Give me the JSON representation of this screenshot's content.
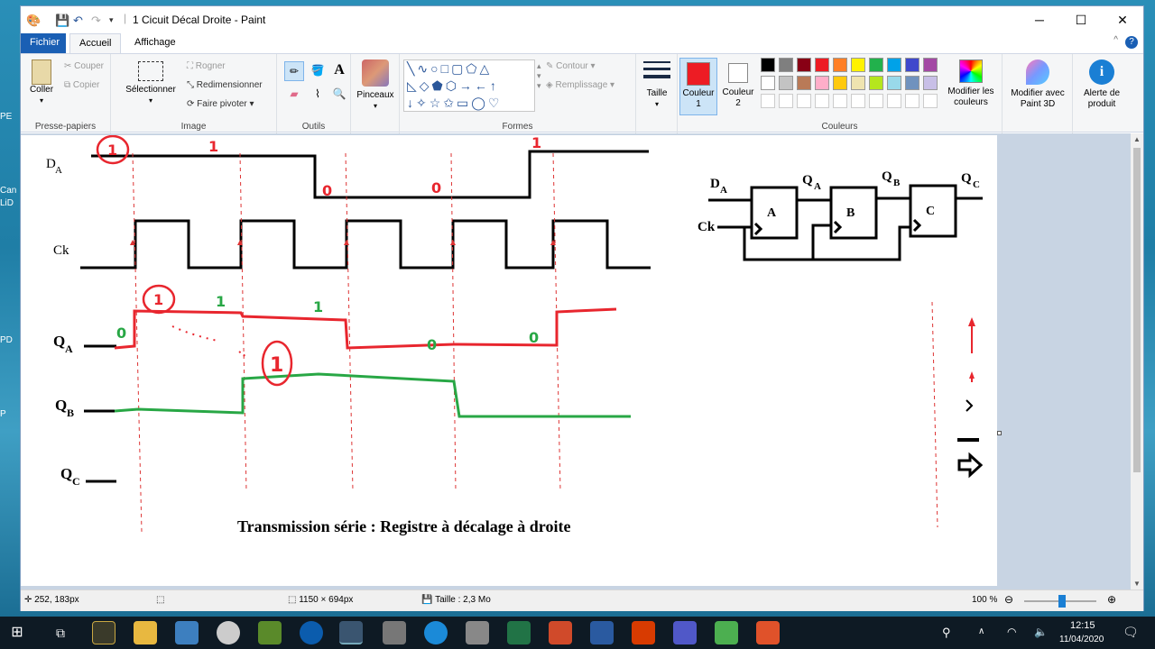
{
  "window": {
    "title": "1 Cicuit Décal Droite - Paint",
    "minimize": "─",
    "maximize": "☐",
    "close": "✕",
    "help": "?",
    "collapse": "^"
  },
  "tabs": {
    "file": "Fichier",
    "home": "Accueil",
    "view": "Affichage"
  },
  "ribbon": {
    "clipboard": {
      "paste": "Coller",
      "cut": "Couper",
      "copy": "Copier",
      "label": "Presse-papiers"
    },
    "image": {
      "select": "Sélectionner",
      "crop": "Rogner",
      "resize": "Redimensionner",
      "rotate": "Faire pivoter",
      "label": "Image"
    },
    "tools": {
      "label": "Outils"
    },
    "brushes": {
      "label": "Pinceaux"
    },
    "shapes": {
      "outline": "Contour",
      "fill": "Remplissage",
      "label": "Formes"
    },
    "size": {
      "label": "Taille"
    },
    "colors": {
      "color1": "Couleur 1",
      "color2": "Couleur 2",
      "edit": "Modifier les couleurs",
      "label": "Couleurs"
    },
    "paint3d": "Modifier avec Paint 3D",
    "alert": "Alerte de produit"
  },
  "palette": [
    "#000000",
    "#7f7f7f",
    "#880015",
    "#ed1c24",
    "#ff7f27",
    "#fff200",
    "#22b14c",
    "#00a2e8",
    "#3f48cc",
    "#a349a4",
    "#ffffff",
    "#c3c3c3",
    "#b97a57",
    "#ffaec9",
    "#ffc90e",
    "#efe4b0",
    "#b5e61d",
    "#99d9ea",
    "#7092be",
    "#c8bfe7"
  ],
  "colors_main": {
    "color1": "#ed1c24",
    "color2": "#ffffff"
  },
  "diagram": {
    "signals": {
      "da": "D",
      "da_sub": "A",
      "ck": "Ck",
      "qa": "Q",
      "qa_sub": "A",
      "qb": "Q",
      "qb_sub": "B",
      "qc": "Q",
      "qc_sub": "C"
    },
    "marks": {
      "one": "1",
      "zero": "0"
    },
    "caption": "Transmission série : Registre à décalage à droite",
    "circuit": {
      "da": "D",
      "da_sub": "A",
      "ck": "Ck",
      "qa": "Q",
      "qa_sub": "A",
      "qb": "Q",
      "qb_sub": "B",
      "qc": "Q",
      "qc_sub": "C",
      "ffA": "A",
      "ffB": "B",
      "ffC": "C"
    }
  },
  "status": {
    "cursor": "252, 183px",
    "dimensions": "1150 × 694px",
    "size": "Taille : 2,3 Mo",
    "zoom": "100 %"
  },
  "taskbar": {
    "time": "12:15",
    "date": "11/04/2020"
  },
  "desktop": {
    "t1": "PE",
    "t2": "Can",
    "t3": "LiD",
    "t4": "PD",
    "t5": "P"
  }
}
